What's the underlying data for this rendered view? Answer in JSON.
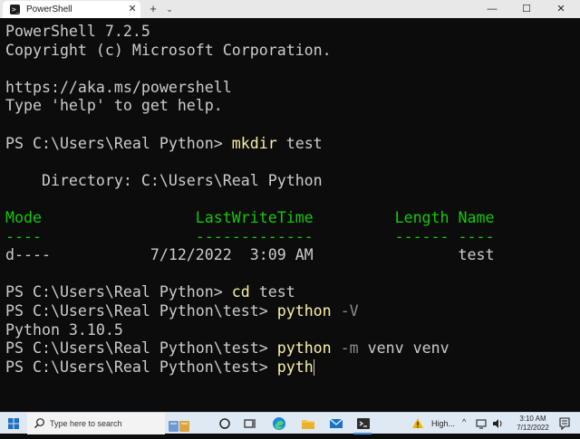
{
  "window": {
    "tab_title": "PowerShell",
    "tab_icon": "powershell-icon",
    "close_tab_glyph": "✕",
    "new_tab_glyph": "+",
    "dropdown_glyph": "⌄",
    "minimize_glyph": "—",
    "maximize_glyph": "☐",
    "close_glyph": "✕"
  },
  "terminal": {
    "colors": {
      "background": "#0c0c0c",
      "text": "#cccccc",
      "command": "#f9f1a5",
      "parameter": "#8c8c8c",
      "header": "#16c60c"
    },
    "lines": [
      "PowerShell 7.2.5",
      "Copyright (c) Microsoft Corporation.",
      "",
      "https://aka.ms/powershell",
      "Type 'help' to get help.",
      "",
      "PS C:\\Users\\Real Python> mkdir test",
      "",
      "    Directory: C:\\Users\\Real Python",
      "",
      "Mode                 LastWriteTime         Length Name",
      "----                 -------------         ------ ----",
      "d----           7/12/2022  3:09 AM                test",
      "",
      "PS C:\\Users\\Real Python> cd test",
      "PS C:\\Users\\Real Python\\test> python -V",
      "Python 3.10.5",
      "PS C:\\Users\\Real Python\\test> python -m venv venv",
      "PS C:\\Users\\Real Python\\test> pyth"
    ],
    "commands": [
      {
        "prompt": "PS C:\\Users\\Real Python> ",
        "cmd": "mkdir",
        "args": " test",
        "param": ""
      },
      {
        "prompt": "PS C:\\Users\\Real Python> ",
        "cmd": "cd",
        "args": " test",
        "param": ""
      },
      {
        "prompt": "PS C:\\Users\\Real Python\\test> ",
        "cmd": "python",
        "args": "",
        "param": " -V"
      },
      {
        "prompt": "PS C:\\Users\\Real Python\\test> ",
        "cmd": "python",
        "args": " venv venv",
        "param": " -m"
      },
      {
        "prompt": "PS C:\\Users\\Real Python\\test> ",
        "cmd": "pyth",
        "args": "",
        "param": ""
      }
    ],
    "listing": {
      "header_row": "Mode                 LastWriteTime         Length Name",
      "rule_row": "----                 -------------         ------ ----",
      "entry_row": "d----           7/12/2022  3:09 AM                test"
    }
  },
  "taskbar": {
    "search_placeholder": "Type here to search",
    "tray_label": "High...",
    "tray_chevron": "^",
    "time": "3:10 AM",
    "date": "7/12/2022",
    "icons": [
      "windows-start-icon",
      "search-icon",
      "task-view-icon",
      "edge-icon",
      "file-explorer-icon",
      "mail-icon",
      "terminal-icon",
      "warning-icon",
      "network-icon",
      "volume-icon",
      "notifications-icon"
    ]
  }
}
